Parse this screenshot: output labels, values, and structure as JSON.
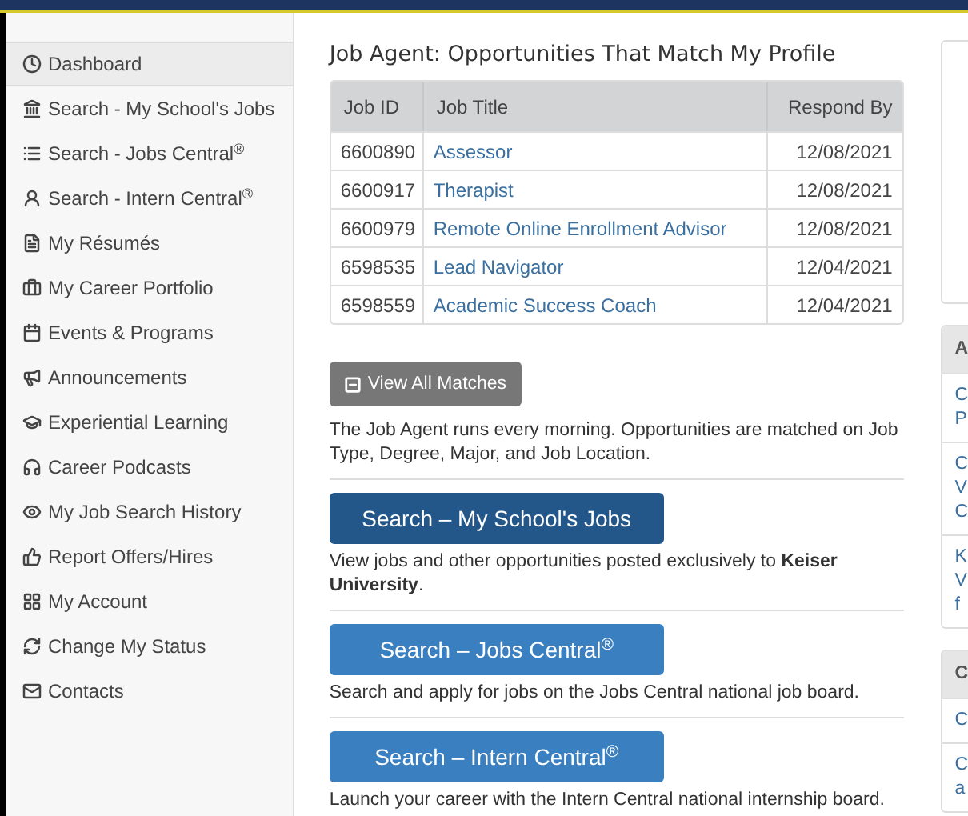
{
  "sidebar": {
    "items": [
      {
        "label": "Dashboard",
        "selected": true
      },
      {
        "label": "Search - My School's Jobs",
        "selected": false
      },
      {
        "label": "Search - Jobs Central$^{®}$",
        "selected": false
      },
      {
        "label": "Search - Intern Central$^{®}$",
        "selected": false
      },
      {
        "label": "My Résumés",
        "selected": false
      },
      {
        "label": "My Career Portfolio",
        "selected": false
      },
      {
        "label": "Events & Programs",
        "selected": false
      },
      {
        "label": "Announcements",
        "selected": false
      },
      {
        "label": "Experiential Learning",
        "selected": false
      },
      {
        "label": "Career Podcasts",
        "selected": false
      },
      {
        "label": "My Job Search History",
        "selected": false
      },
      {
        "label": "Report Offers/Hires",
        "selected": false
      },
      {
        "label": "My Account",
        "selected": false
      },
      {
        "label": "Change My Status",
        "selected": false
      },
      {
        "label": "Contacts",
        "selected": false
      }
    ]
  },
  "job_agent": {
    "title": "Job Agent: Opportunities That Match My Profile",
    "table": {
      "columns": [
        "Job ID",
        "Job Title",
        "Respond By"
      ],
      "rows": [
        [
          "6600890",
          "Assessor",
          "12/08/2021"
        ],
        [
          "6600917",
          "Therapist",
          "12/08/2021"
        ],
        [
          "6600979",
          "Remote Online Enrollment Advisor",
          "12/08/2021"
        ],
        [
          "6598535",
          "Lead Navigator",
          "12/04/2021"
        ],
        [
          "6598559",
          "Academic Success Coach",
          "12/04/2021"
        ]
      ]
    },
    "view_all_button": "View All Matches",
    "note": "The Job Agent runs every morning. Opportunities are matched on Job Type, Degree, Major, and Job Location."
  },
  "searches": [
    {
      "button": "Search – My School's Jobs",
      "kind": "dark",
      "text": "View jobs and other opportunities posted exclusively to **Keiser University**."
    },
    {
      "button": "Search – Jobs Central$^{®}$",
      "kind": "light",
      "text": "Search and apply for jobs on the Jobs Central national job board."
    },
    {
      "button": "Search – Intern Central$^{®}$",
      "kind": "light",
      "text": "Launch your career with the Intern Central national internship board."
    }
  ],
  "right_panels": [
    {
      "header": "A",
      "rows": [
        [
          "C",
          "P"
        ],
        [
          "C",
          "V",
          "C"
        ],
        [
          "K",
          "V",
          "f"
        ]
      ]
    },
    {
      "header": "C",
      "rows": [
        [
          "C"
        ],
        [
          "C",
          "a"
        ]
      ]
    }
  ]
}
